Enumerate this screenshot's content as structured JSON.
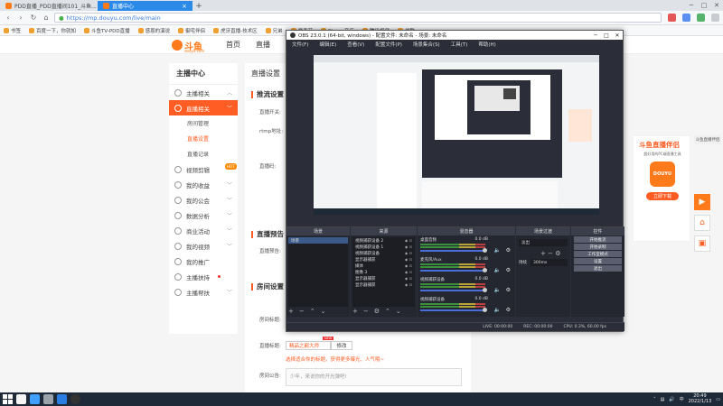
{
  "browser": {
    "tabs": [
      {
        "label": "PDD直播_PDD直播间101_斗鱼..."
      },
      {
        "label": "直播中心",
        "active": true
      }
    ],
    "url": "https://mp.douyu.com/live/main",
    "bookmarks": [
      "书签",
      "百度一下，你就知",
      "斗鱼TV-PDD直播",
      "感恩的演说",
      "御宅伴侣",
      "虎牙直播-技术区",
      "兄弟",
      "爱奇艺",
      "Steam商店",
      "腾讯视频",
      "优酷"
    ]
  },
  "site": {
    "logo": "斗鱼",
    "logo_sub": "douyu.com",
    "nav": [
      "首页",
      "直播"
    ],
    "sidebar": {
      "title": "主播中心",
      "items": [
        {
          "label": "主播相关",
          "arrow": "︿"
        },
        {
          "label": "直播相关",
          "arrow": "﹀",
          "active": true
        },
        {
          "label": "视频剪辑",
          "badge": "HOT"
        },
        {
          "label": "我的收益",
          "arrow": "﹀"
        },
        {
          "label": "我的公会",
          "arrow": "﹀"
        },
        {
          "label": "数据分析",
          "arrow": "﹀"
        },
        {
          "label": "商业活动",
          "arrow": "﹀"
        },
        {
          "label": "我的视频",
          "arrow": "﹀"
        },
        {
          "label": "我的推广"
        },
        {
          "label": "主播扶持",
          "dot": true
        },
        {
          "label": "主播帮扶",
          "arrow": "﹀"
        }
      ],
      "sub": [
        "房间管理",
        "直播设置",
        "直播记录"
      ]
    },
    "main": {
      "crumb": "直播设置",
      "sections": [
        "推流设置",
        "直播预告",
        "房间设置"
      ],
      "labels": [
        "直播开关:",
        "rtmp地址:",
        "直播码:",
        "直播预告:",
        "房间标题:",
        "直播标题:",
        "房间公告:"
      ],
      "room_badge": "NEW",
      "room_title_value": "精品之巅大师",
      "modify_label": "修改",
      "room_hint": "选择适合你的标题，获得更多曝光、人气哦~",
      "notice_placeholder": "少年，来说你的开光弹吧!"
    },
    "promo": {
      "title": "斗鱼直播伴侣",
      "subtitle": "超好用的PC端直播工具",
      "app_label": "DOUYU",
      "download": "立即下载",
      "tag": "斗鱼直播伴侣"
    }
  },
  "obs": {
    "title": "OBS 23.0.1 (64-bit, windows) - 配置文件: 未命名 - 场景: 未命名",
    "menu": [
      "文件(F)",
      "编辑(E)",
      "查看(V)",
      "配置文件(P)",
      "场景集合(S)",
      "工具(T)",
      "帮助(H)"
    ],
    "docks": {
      "scenes": {
        "title": "场景",
        "items": [
          "场景"
        ]
      },
      "sources": {
        "title": "来源",
        "items": [
          "视频捕获设备 2",
          "视频捕获设备 1",
          "视频捕获设备",
          "显示器捕获",
          "媒体",
          "图像 3",
          "显示器捕获",
          "显示器捕获"
        ]
      },
      "mixer": {
        "title": "混音器",
        "rows": [
          {
            "name": "桌面音频",
            "db": "0.0 dB"
          },
          {
            "name": "麦克风/Aux",
            "db": "0.0 dB"
          },
          {
            "name": "视频捕获设备",
            "db": "0.0 dB"
          },
          {
            "name": "视频捕获设备",
            "db": "0.0 dB"
          }
        ]
      },
      "transitions": {
        "title": "场景过渡",
        "fade": "淡出",
        "duration_label": "持续",
        "duration": "300ms"
      },
      "controls": {
        "title": "控件",
        "buttons": [
          "开始推流",
          "开始录制",
          "工作室模式",
          "设置",
          "退出"
        ]
      }
    },
    "status": {
      "live": "LIVE: 00:00:00",
      "rec": "REC: 00:00:00",
      "cpu": "CPU: 0.3%, 60.00 fps"
    }
  },
  "taskbar": {
    "time": "20:49",
    "date": "2022/1/13",
    "lang": "中"
  }
}
